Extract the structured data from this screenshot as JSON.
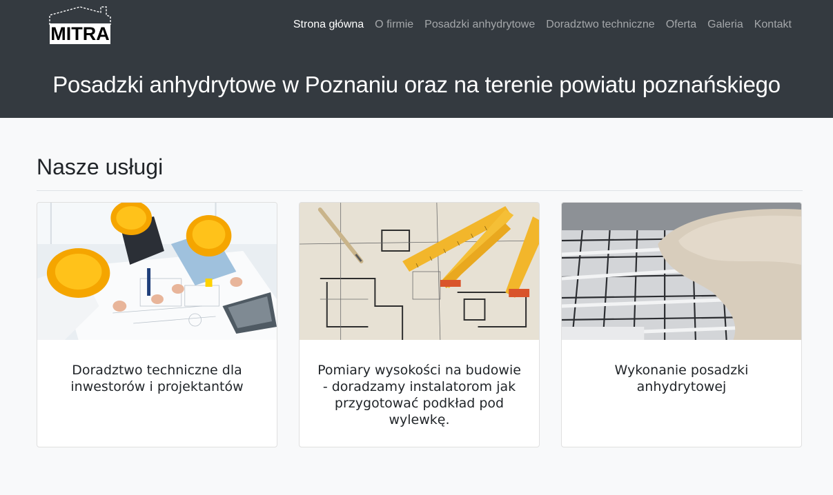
{
  "brand": {
    "logo_text": "MITRA"
  },
  "nav": {
    "items": [
      {
        "label": "Strona główna",
        "active": true
      },
      {
        "label": "O firmie",
        "active": false
      },
      {
        "label": "Posadzki anhydrytowe",
        "active": false
      },
      {
        "label": "Doradztwo techniczne",
        "active": false
      },
      {
        "label": "Oferta",
        "active": false
      },
      {
        "label": "Galeria",
        "active": false
      },
      {
        "label": "Kontakt",
        "active": false
      }
    ]
  },
  "hero": {
    "title": "Posadzki anhydrytowe w Poznaniu oraz na terenie powiatu poznańskiego"
  },
  "services": {
    "heading": "Nasze usługi",
    "cards": [
      {
        "title": "Doradztwo techniczne dla inwestorów i projektantów",
        "image": "engineers-with-hardhats-photo"
      },
      {
        "title": "Pomiary wysokości na budowie - doradzamy instalatorom jak przygotować podkład pod wylewkę.",
        "image": "blueprints-and-folding-ruler-photo"
      },
      {
        "title": "Wykonanie posadzki anhydrytowej",
        "image": "floor-heating-screed-photo"
      }
    ]
  },
  "colors": {
    "header_bg": "#343a40",
    "page_bg": "#f8f9fa",
    "accent_yellow": "#f4b400"
  }
}
